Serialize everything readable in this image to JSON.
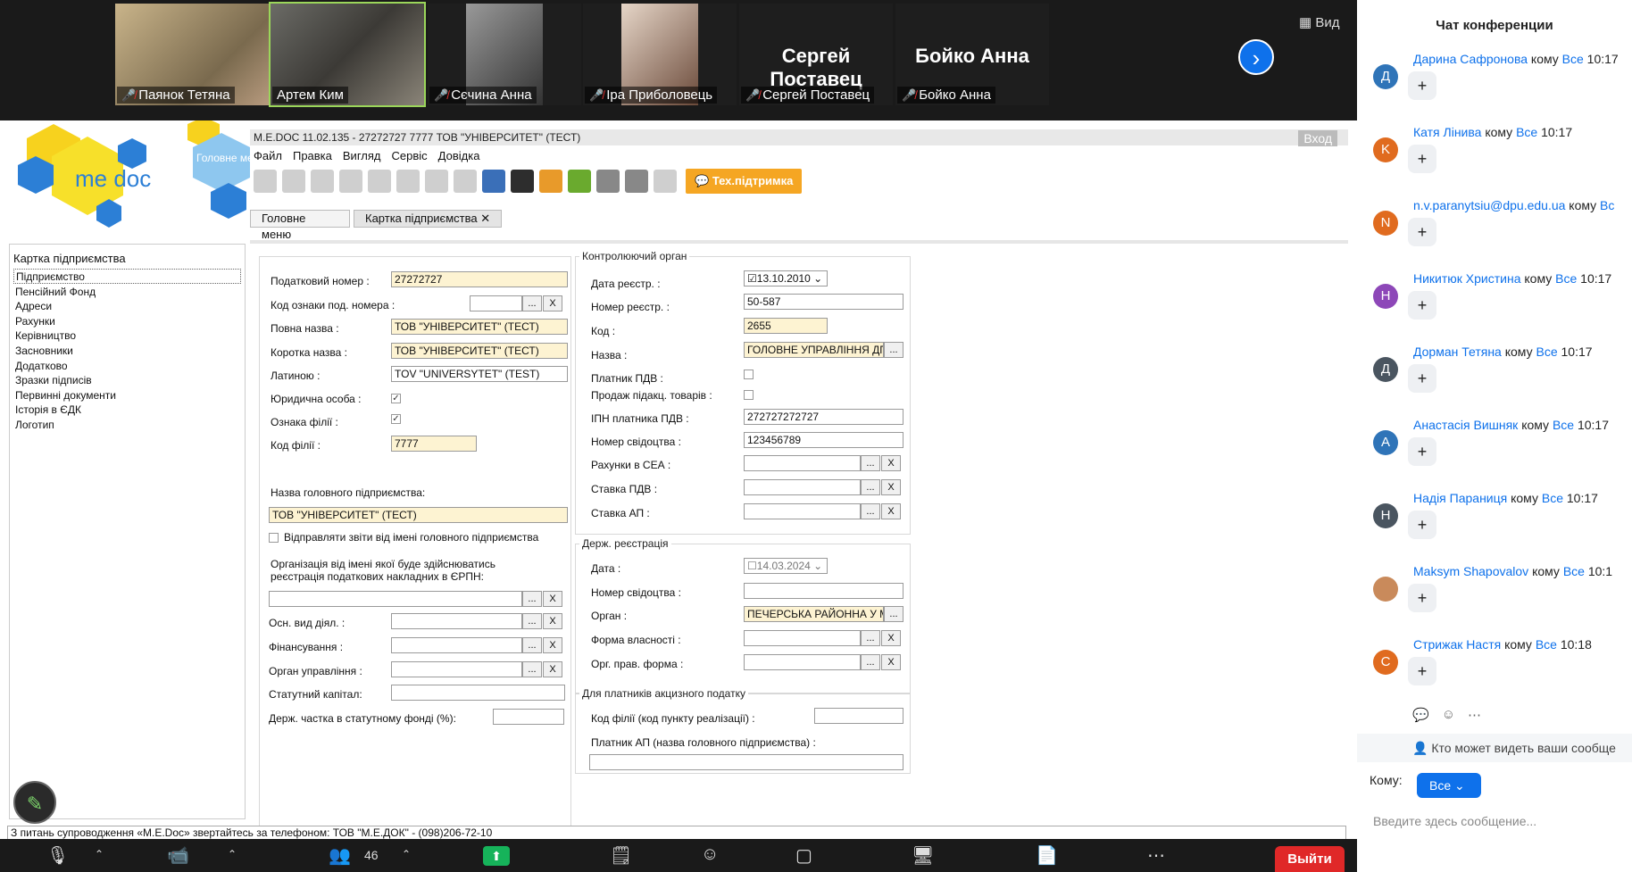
{
  "participants": [
    {
      "name": "Паянок Тетяна",
      "muted": true
    },
    {
      "name": "Артем Ким",
      "muted": false
    },
    {
      "name": "Сєчина Анна",
      "muted": true
    },
    {
      "name": "Іра Приболовець",
      "muted": true
    },
    {
      "name": "Сергей Поставец",
      "muted": true,
      "big_label": "Сергей Поставец"
    },
    {
      "name": "Бойко Анна",
      "muted": true,
      "big_label": "Бойко Анна"
    }
  ],
  "view_label": "Вид",
  "app": {
    "logo_text": "me doc",
    "main_menu_logo": "Головне меню",
    "title": "M.E.DOC 11.02.135  - 27272727 7777 ТОВ \"УНІВЕРСИТЕТ\" (ТЕСТ)",
    "window_button": "Вход",
    "menu": [
      "Файл",
      "Правка",
      "Вигляд",
      "Сервіс",
      "Довідка"
    ],
    "support_label": "Тех.підтримка",
    "tabs": [
      "Головне меню",
      "Картка підприємства"
    ],
    "tab_close": "✕",
    "sidebar_title": "Картка підприємства",
    "sidebar_items": [
      "Підприємство",
      "Пенсійний Фонд",
      "Адреси",
      "Рахунки",
      "Керівництво",
      "Засновники",
      "Додатково",
      "Зразки підписів",
      "Первинні документи",
      "Історія в ЄДК",
      "Логотип"
    ],
    "form": {
      "tax_number_label": "Податковий номер :",
      "tax_number": "27272727",
      "sign_code_label": "Код ознаки под. номера :",
      "full_name_label": "Повна назва :",
      "full_name": "ТОВ \"УНІВЕРСИТЕТ\" (ТЕСТ)",
      "short_name_label": "Коротка назва :",
      "short_name": "ТОВ \"УНІВЕРСИТЕТ\" (ТЕСТ)",
      "latin_label": "Латиною :",
      "latin": "TOV \"UNIVERSYTET\" (TEST)",
      "legal_entity_label": "Юридична особа :",
      "branch_sign_label": "Ознака філії :",
      "branch_code_label": "Код філії :",
      "branch_code": "7777",
      "parent_name_label": "Назва головного підприємства:",
      "parent_name": "ТОВ \"УНІВЕРСИТЕТ\" (ТЕСТ)",
      "send_reports_label": "Відправляти звіти від імені головного підприємства",
      "erpn_label_1": "Організація від імені якої буде здійснюватись",
      "erpn_label_2": "реєстрація податкових накладних в ЄРПН:",
      "activity_label": "Осн. вид діял. :",
      "financing_label": "Фінансування :",
      "mgmt_label": "Орган управління :",
      "capital_label": "Статутний капітал:",
      "state_share_label": "Держ. частка в статутному фонді (%):"
    },
    "control": {
      "group_title": "Контролюючий орган",
      "reg_date_label": "Дата реєстр. :",
      "reg_date": "13.10.2010",
      "reg_number_label": "Номер реєстр. :",
      "reg_number": "50-587",
      "code_label": "Код :",
      "code": "2655",
      "name_label": "Назва :",
      "name": "ГОЛОВНЕ УПРАВЛІННЯ ДПС",
      "vat_payer_label": "Платник ПДВ :",
      "excise_label": "Продаж підакц. товарів :",
      "vat_ipn_label": "ІПН платника ПДВ :",
      "vat_ipn": "272727272727",
      "cert_number_label": "Номер свідоцтва :",
      "cert_number": "123456789",
      "sea_accounts_label": "Рахунки в СЕА :",
      "vat_rate_label": "Ставка ПДВ :",
      "ap_rate_label": "Ставка АП :"
    },
    "state_reg": {
      "group_title": "Держ. реєстрація",
      "date_label": "Дата :",
      "date": "14.03.2024",
      "cert_label": "Номер свідоцтва :",
      "organ_label": "Орган :",
      "organ": "ПЕЧЕРСЬКА РАЙОННА У М",
      "ownership_label": "Форма власності :",
      "legal_form_label": "Орг. прав. форма :"
    },
    "excise": {
      "group_title": "Для платників акцизного податку",
      "branch_code_label": "Код філії (код пункту реалізації) :",
      "payer_label": "Платник АП (назва головного підприємства) :"
    },
    "status_bar": "З питань супроводження «M.E.Doc» звертайтесь за телефоном: ТОВ \"М.Е.ДОК\" - (098)206-72-10"
  },
  "chat": {
    "title": "Чат конференции",
    "to_word": "кому",
    "messages": [
      {
        "sender": "Дарина Сафронова",
        "to": "Все",
        "time": "10:17",
        "initial": "Д",
        "color": "#2f74b8"
      },
      {
        "sender": "Катя Лінива",
        "to": "Все",
        "time": "10:17",
        "initial": "K",
        "color": "#e06b1f"
      },
      {
        "sender": "n.v.paranytsiu@dpu.edu.ua",
        "to": "Вс",
        "time": "",
        "initial": "N",
        "color": "#e06b1f"
      },
      {
        "sender": "Никитюк Христина",
        "to": "Все",
        "time": "10:17",
        "initial": "Н",
        "color": "#8d47b8"
      },
      {
        "sender": "Дорман Тетяна",
        "to": "Все",
        "time": "10:17",
        "initial": "Д",
        "color": "#4a5560"
      },
      {
        "sender": "Анастасія Вишняк",
        "to": "Все",
        "time": "10:17",
        "initial": "А",
        "color": "#2f74b8"
      },
      {
        "sender": "Надія Параниця",
        "to": "Все",
        "time": "10:17",
        "initial": "Н",
        "color": "#4a5560"
      },
      {
        "sender": "Maksym Shapovalov",
        "to": "Все",
        "time": "10:1",
        "initial": "",
        "color": "#c98a5b"
      },
      {
        "sender": "Стрижак Настя",
        "to": "Все",
        "time": "10:18",
        "initial": "С",
        "color": "#e06b1f"
      }
    ],
    "plus": "+",
    "visibility_text": "Кто может видеть ваши сообще",
    "to_label": "Кому:",
    "to_value": "Все",
    "input_placeholder": "Введите здесь сообщение..."
  },
  "controls": {
    "participants_count": "46",
    "leave_label": "Выйти"
  },
  "colors": {
    "accent": "#0e71eb",
    "leave": "#e02828",
    "share": "#16b35a",
    "support": "#f5a623",
    "field_yellow": "#fdf3d2"
  }
}
